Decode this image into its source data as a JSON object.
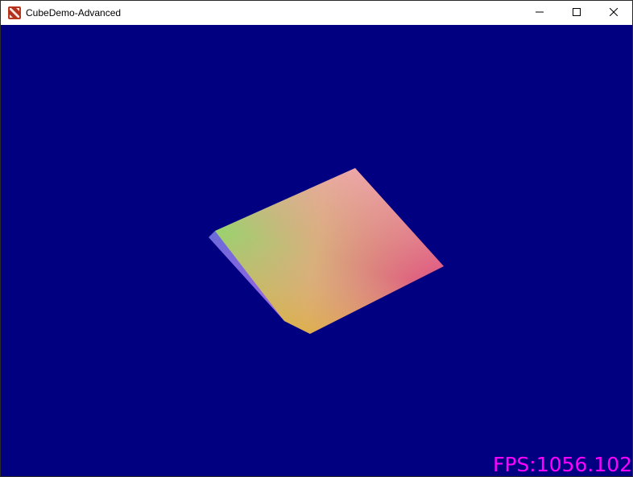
{
  "window": {
    "title": "CubeDemo-Advanced",
    "app_icon": "dota-logo-icon",
    "controls": {
      "minimize_icon": "minimize-icon",
      "maximize_icon": "maximize-icon",
      "close_icon": "close-icon"
    }
  },
  "viewport": {
    "background_color": "#000080",
    "fps_text": "FPS:1056.102",
    "fps_color": "#ff00ff"
  }
}
